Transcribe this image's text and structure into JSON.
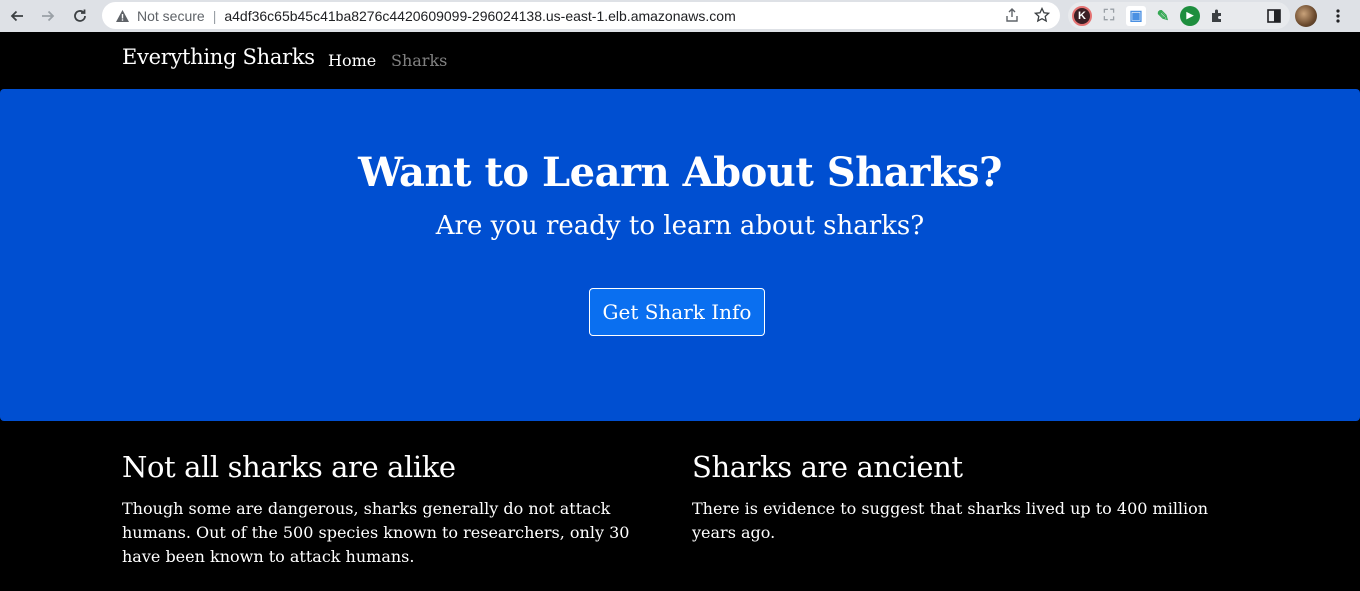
{
  "browser": {
    "security_label": "Not secure",
    "url": "a4df36c65b45c41ba8276c4420609099-296024138.us-east-1.elb.amazonaws.com",
    "icons": [
      "back-icon",
      "forward-icon",
      "reload-icon",
      "warning-icon",
      "share-icon",
      "star-icon",
      "extensions-icon",
      "side-panel-icon",
      "profile-avatar",
      "menu-icon"
    ],
    "extensions": [
      {
        "name": "k-extension",
        "letter": "K",
        "color": "#5a2630"
      },
      {
        "name": "screenshot-extension",
        "letter": "⛶",
        "color": "#9aa0a6"
      },
      {
        "name": "image-extension",
        "letter": "▣",
        "color": "#4a90e2"
      },
      {
        "name": "pen-extension",
        "letter": "✎",
        "color": "#34a853"
      },
      {
        "name": "play-extension",
        "letter": "▶",
        "color": "#1e8e3e"
      }
    ]
  },
  "site": {
    "brand": "Everything Sharks",
    "nav": {
      "home": "Home",
      "sharks": "Sharks"
    }
  },
  "hero": {
    "title": "Want to Learn About Sharks?",
    "subtitle": "Are you ready to learn about sharks?",
    "button": "Get Shark Info",
    "background_color": "#004fd1"
  },
  "columns": {
    "left": {
      "heading": "Not all sharks are alike",
      "body": "Though some are dangerous, sharks generally do not attack humans. Out of the 500 species known to researchers, only 30 have been known to attack humans."
    },
    "right": {
      "heading": "Sharks are ancient",
      "body": "There is evidence to suggest that sharks lived up to 400 million years ago."
    }
  }
}
